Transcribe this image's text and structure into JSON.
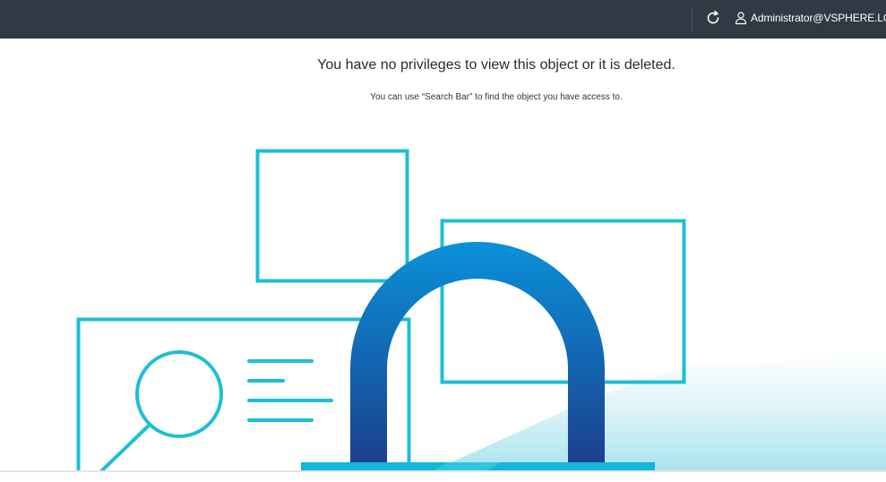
{
  "header": {
    "user": "Administrator@VSPHERE.LOCA",
    "icons": {
      "refresh": "refresh-icon",
      "user": "user-icon"
    },
    "colors": {
      "background": "#2f3a44",
      "foreground": "#ffffff"
    }
  },
  "message": {
    "title": "You have no privileges to view this object or it is deleted.",
    "hint": "You can use “Search Bar” to find the object you have access to."
  },
  "illustration": {
    "icons": [
      "lock-icon",
      "magnifier-icon"
    ],
    "colors": {
      "outline": "#1bbfd6",
      "lock_top": "#0a91d9",
      "lock_bottom": "#1c3f8c",
      "lock_base": "#12b6d8",
      "floor": "#b9e8f1"
    }
  }
}
